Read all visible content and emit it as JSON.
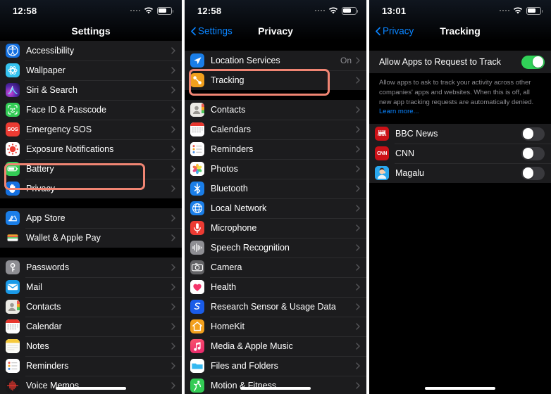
{
  "panels": [
    {
      "id": "settings",
      "statusbar": {
        "time": "12:58",
        "wifi_icon": "wifi-icon",
        "battery_icon": "battery-icon",
        "signal_icon": "signal-dots-icon"
      },
      "nav": {
        "title": "Settings",
        "back": null
      },
      "groups": [
        {
          "rows": [
            {
              "label": "Accessibility",
              "icon": "accessibility-icon",
              "icon_bg": "#1470e0",
              "chevron": true
            },
            {
              "label": "Wallpaper",
              "icon": "wallpaper-icon",
              "icon_bg": "#35c3f0",
              "chevron": true
            },
            {
              "label": "Siri & Search",
              "icon": "siri-icon",
              "icon_bg": "#3b2a6e",
              "chevron": true
            },
            {
              "label": "Face ID & Passcode",
              "icon": "faceid-icon",
              "icon_bg": "#33cc55",
              "chevron": true
            },
            {
              "label": "Emergency SOS",
              "icon": "sos-icon",
              "icon_bg": "#ec3b33",
              "chevron": true
            },
            {
              "label": "Exposure Notifications",
              "icon": "exposure-notifications-icon",
              "icon_bg": "#ffffff",
              "chevron": true
            },
            {
              "label": "Battery",
              "icon": "battery-settings-icon",
              "icon_bg": "#33cc55",
              "chevron": true
            },
            {
              "label": "Privacy",
              "icon": "privacy-hand-icon",
              "icon_bg": "#1470e0",
              "chevron": true,
              "highlighted": true
            }
          ]
        },
        {
          "rows": [
            {
              "label": "App Store",
              "icon": "app-store-icon",
              "icon_bg": "#1a7ee8",
              "chevron": true
            },
            {
              "label": "Wallet & Apple Pay",
              "icon": "wallet-icon",
              "icon_bg": "#1c1c1e",
              "chevron": true
            }
          ]
        },
        {
          "rows": [
            {
              "label": "Passwords",
              "icon": "passwords-key-icon",
              "icon_bg": "#8e8e93",
              "chevron": true
            },
            {
              "label": "Mail",
              "icon": "mail-icon",
              "icon_bg": "#1a9ae8",
              "chevron": true
            },
            {
              "label": "Contacts",
              "icon": "contacts-icon",
              "icon_bg": "#e8e6e1",
              "chevron": true
            },
            {
              "label": "Calendar",
              "icon": "calendar-icon",
              "icon_bg": "#ffffff",
              "chevron": true
            },
            {
              "label": "Notes",
              "icon": "notes-icon",
              "icon_bg": "#ffffff",
              "chevron": true
            },
            {
              "label": "Reminders",
              "icon": "reminders-icon",
              "icon_bg": "#ffffff",
              "chevron": true
            },
            {
              "label": "Voice Memos",
              "icon": "voice-memos-icon",
              "icon_bg": "#1c1c1e",
              "chevron": true
            }
          ]
        }
      ]
    },
    {
      "id": "privacy",
      "statusbar": {
        "time": "12:58",
        "wifi_icon": "wifi-icon",
        "battery_icon": "battery-icon",
        "signal_icon": "signal-dots-icon"
      },
      "nav": {
        "title": "Privacy",
        "back": "Settings"
      },
      "groups": [
        {
          "rows": [
            {
              "label": "Location Services",
              "icon": "location-services-icon",
              "icon_bg": "#1a7ee8",
              "value": "On",
              "chevron": true
            },
            {
              "label": "Tracking",
              "icon": "tracking-icon",
              "icon_bg": "#f2a01d",
              "chevron": true,
              "highlighted": true
            }
          ]
        },
        {
          "rows": [
            {
              "label": "Contacts",
              "icon": "contacts-icon",
              "icon_bg": "#e8e6e1",
              "chevron": true
            },
            {
              "label": "Calendars",
              "icon": "calendar-icon",
              "icon_bg": "#ffffff",
              "chevron": true
            },
            {
              "label": "Reminders",
              "icon": "reminders-icon",
              "icon_bg": "#ffffff",
              "chevron": true
            },
            {
              "label": "Photos",
              "icon": "photos-icon",
              "icon_bg": "#ffffff",
              "chevron": true
            },
            {
              "label": "Bluetooth",
              "icon": "bluetooth-icon",
              "icon_bg": "#1a7ee8",
              "chevron": true
            },
            {
              "label": "Local Network",
              "icon": "local-network-icon",
              "icon_bg": "#1a7ee8",
              "chevron": true
            },
            {
              "label": "Microphone",
              "icon": "microphone-icon",
              "icon_bg": "#ec3b33",
              "chevron": true
            },
            {
              "label": "Speech Recognition",
              "icon": "speech-recognition-icon",
              "icon_bg": "#8e8e93",
              "chevron": true
            },
            {
              "label": "Camera",
              "icon": "camera-icon",
              "icon_bg": "#636366",
              "chevron": true
            },
            {
              "label": "Health",
              "icon": "health-icon",
              "icon_bg": "#ffffff",
              "chevron": true
            },
            {
              "label": "Research Sensor & Usage Data",
              "icon": "research-sensor-icon",
              "icon_bg": "#1a5ce8",
              "chevron": true
            },
            {
              "label": "HomeKit",
              "icon": "homekit-icon",
              "icon_bg": "#f2a01d",
              "chevron": true
            },
            {
              "label": "Media & Apple Music",
              "icon": "media-apple-music-icon",
              "icon_bg": "#f4336a",
              "chevron": true
            },
            {
              "label": "Files and Folders",
              "icon": "files-folders-icon",
              "icon_bg": "#35b8f0",
              "chevron": true
            },
            {
              "label": "Motion & Fitness",
              "icon": "motion-fitness-icon",
              "icon_bg": "#33cc55",
              "chevron": true
            }
          ]
        }
      ]
    },
    {
      "id": "tracking",
      "statusbar": {
        "time": "13:01",
        "wifi_icon": "wifi-icon",
        "battery_icon": "battery-icon",
        "signal_icon": "signal-dots-icon"
      },
      "nav": {
        "title": "Tracking",
        "back": "Privacy"
      },
      "master_toggle": {
        "label": "Allow Apps to Request to Track",
        "state": "on"
      },
      "footnote": {
        "text": "Allow apps to ask to track your activity across other companies' apps and websites. When this is off, all new app tracking requests are automatically denied. ",
        "link": "Learn more..."
      },
      "apps": [
        {
          "label": "BBC News",
          "icon": "bbc-news-icon",
          "icon_bg": "#cc1117",
          "state": "off"
        },
        {
          "label": "CNN",
          "icon": "cnn-icon",
          "icon_bg": "#cc1117",
          "state": "off"
        },
        {
          "label": "Magalu",
          "icon": "magalu-icon",
          "icon_bg": "#1a9ae8",
          "state": "off"
        }
      ]
    }
  ],
  "colors": {
    "highlight": "#f08573",
    "accent_blue": "#0a84ff",
    "toggle_on": "#31d158",
    "toggle_off": "#39393d",
    "list_bg": "#1c1c1e",
    "page_bg": "#000000",
    "secondary_text": "#8e8e93"
  }
}
